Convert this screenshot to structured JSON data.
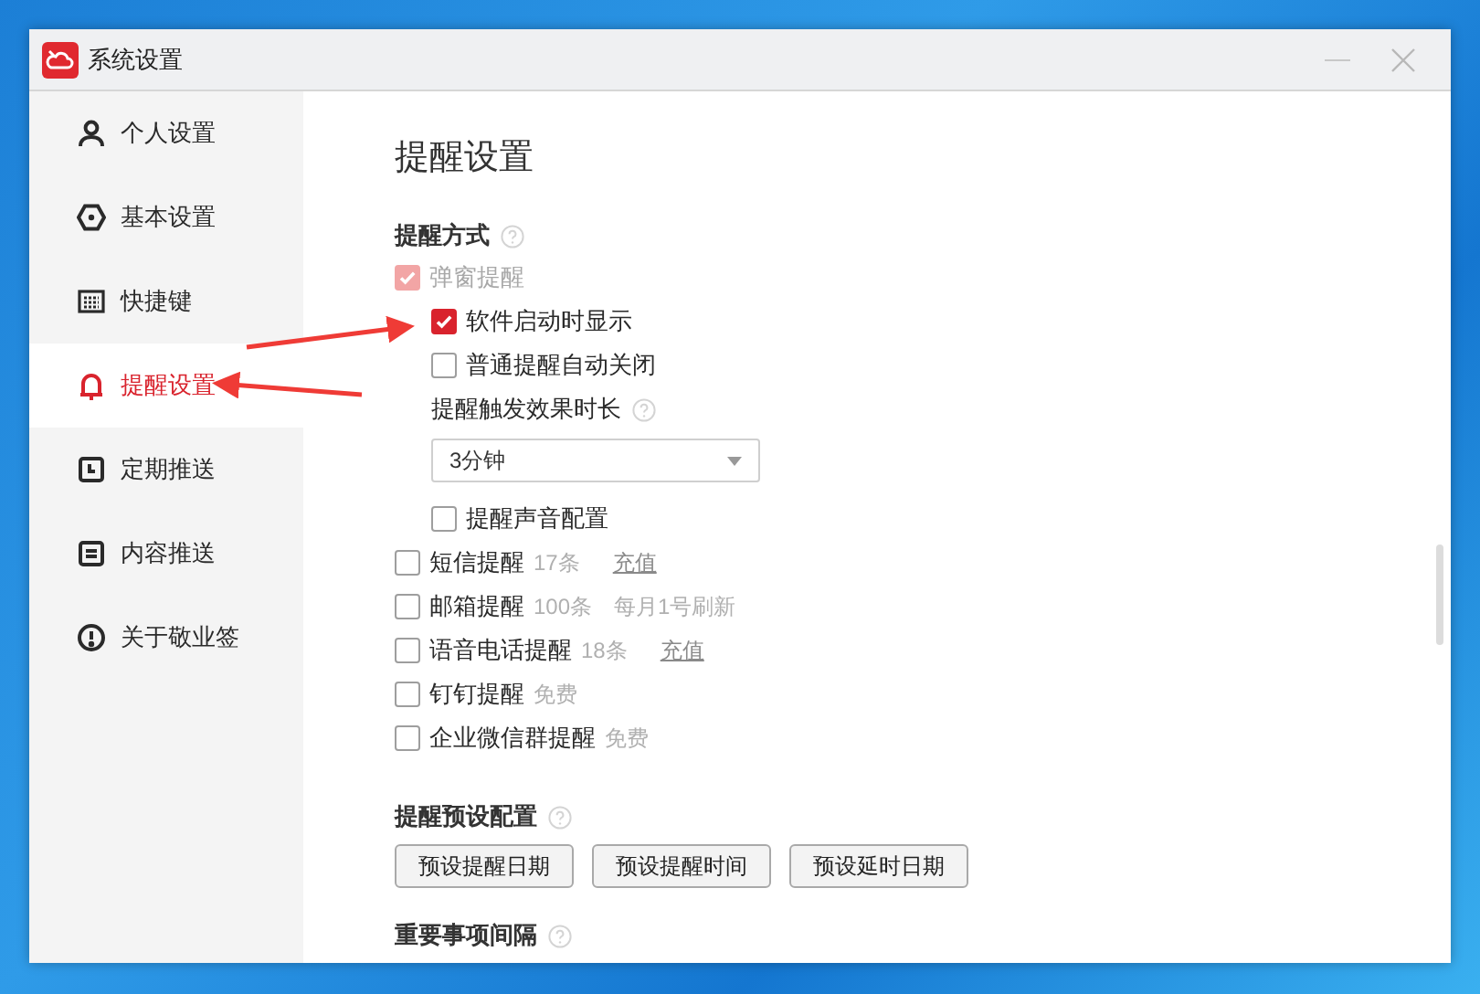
{
  "window": {
    "title": "系统设置"
  },
  "sidebar": {
    "items": [
      {
        "label": "个人设置",
        "selected": false
      },
      {
        "label": "基本设置",
        "selected": false
      },
      {
        "label": "快捷键",
        "selected": false
      },
      {
        "label": "提醒设置",
        "selected": true
      },
      {
        "label": "定期推送",
        "selected": false
      },
      {
        "label": "内容推送",
        "selected": false
      },
      {
        "label": "关于敬业签",
        "selected": false
      }
    ]
  },
  "page_title": "提醒设置",
  "sections": [
    {
      "title": "提醒方式",
      "items": [
        {
          "kind": "checkbox",
          "label": "弹窗提醒",
          "checked": true,
          "disabled": true,
          "children": [
            {
              "kind": "checkbox",
              "label": "软件启动时显示",
              "checked": true,
              "disabled": false
            },
            {
              "kind": "checkbox",
              "label": "普通提醒自动关闭",
              "checked": false,
              "disabled": false
            },
            {
              "kind": "label",
              "label": "提醒触发效果时长"
            },
            {
              "kind": "select",
              "value": "3分钟"
            },
            {
              "kind": "checkbox",
              "label": "提醒声音配置",
              "checked": false,
              "disabled": false
            }
          ]
        },
        {
          "kind": "checkbox",
          "label": "短信提醒",
          "checked": false,
          "disabled": false,
          "note": "17条",
          "link": "充值"
        },
        {
          "kind": "checkbox",
          "label": "邮箱提醒",
          "checked": false,
          "disabled": false,
          "note": "100条",
          "note_2": "每月1号刷新"
        },
        {
          "kind": "checkbox",
          "label": "语音电话提醒",
          "checked": false,
          "disabled": false,
          "note": "18条",
          "link": "充值"
        },
        {
          "kind": "checkbox",
          "label": "钉钉提醒",
          "checked": false,
          "disabled": false,
          "note": "免费"
        },
        {
          "kind": "checkbox",
          "label": "企业微信群提醒",
          "checked": false,
          "disabled": false,
          "note": "免费"
        }
      ]
    },
    {
      "title": "提醒预设配置",
      "buttons": [
        "预设提醒日期",
        "预设提醒时间",
        "预设延时日期"
      ]
    },
    {
      "title": "重要事项间隔"
    }
  ]
}
